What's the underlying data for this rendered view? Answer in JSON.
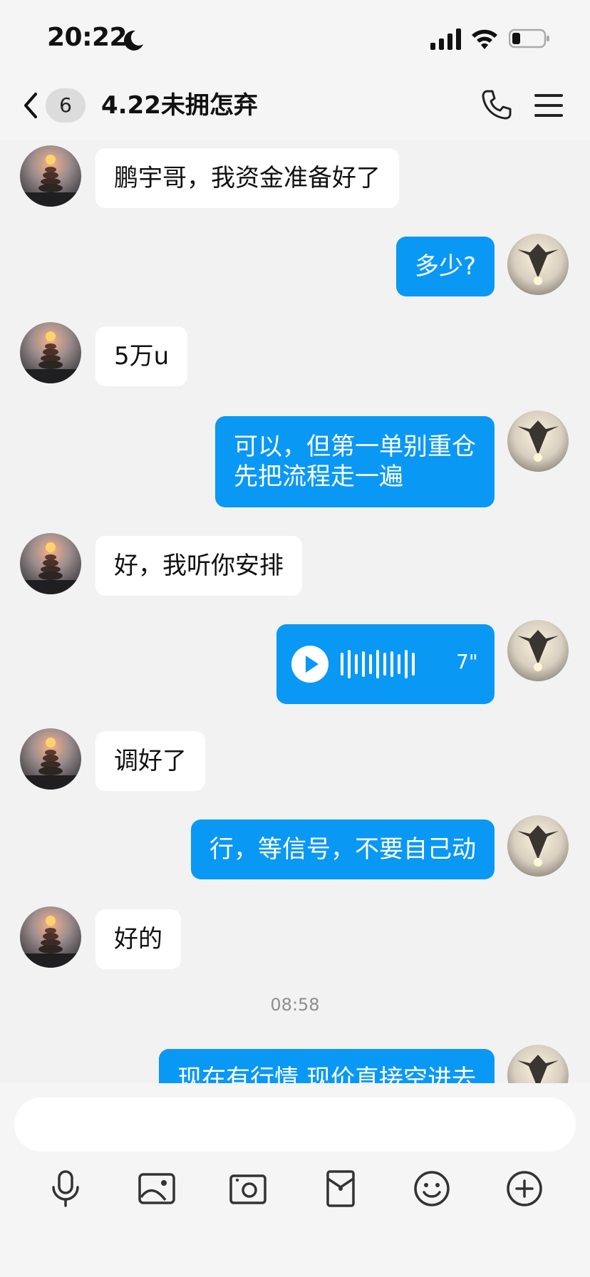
{
  "status_bar": {
    "time": "20:22",
    "icons": [
      "moon-icon",
      "signal-icon",
      "wifi-icon",
      "battery-icon"
    ]
  },
  "nav": {
    "unread_count": "6",
    "title": "4.22未拥怎弃",
    "icons": [
      "back-icon",
      "phone-icon",
      "menu-icon"
    ]
  },
  "messages": [
    {
      "from": "contact",
      "text": "鹏宇哥，我资金准备好了"
    },
    {
      "from": "me",
      "text": "多少?"
    },
    {
      "from": "contact",
      "text": "5万u"
    },
    {
      "from": "me",
      "text": "可以，但第一单别重仓\n先把流程走一遍"
    },
    {
      "from": "contact",
      "text": "好，我听你安排"
    },
    {
      "from": "me",
      "type": "voice",
      "duration": "7\""
    },
    {
      "from": "contact",
      "text": "调好了"
    },
    {
      "from": "me",
      "text": "行，等信号，不要自己动"
    },
    {
      "from": "contact",
      "text": "好的"
    },
    {
      "type": "timestamp",
      "text": "08:58"
    },
    {
      "from": "me",
      "text": "现在有行情,现价直接空进去"
    }
  ],
  "input": {
    "placeholder": "",
    "value": ""
  },
  "toolbar": [
    "microphone-icon",
    "image-icon",
    "camera-icon",
    "red-packet-icon",
    "emoji-icon",
    "plus-icon"
  ],
  "colors": {
    "outgoing_bubble": "#0a98f5",
    "incoming_bubble": "#ffffff",
    "background": "#f2f2f2"
  }
}
